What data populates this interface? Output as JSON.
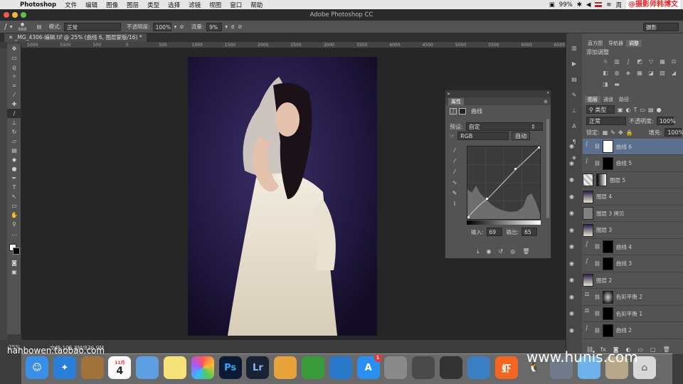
{
  "menubar": {
    "app": "Photoshop",
    "items": [
      "文件",
      "编辑",
      "图像",
      "图层",
      "类型",
      "选择",
      "滤镜",
      "视图",
      "窗口",
      "帮助"
    ],
    "battery": "99%",
    "clock": "周",
    "watermark": "@摄影师韩博文"
  },
  "titlebar": {
    "title": "Adobe Photoshop CC"
  },
  "options": {
    "brush_size": "669",
    "mode_label": "模式:",
    "mode_value": "正常",
    "opacity_label": "不透明度:",
    "opacity_value": "100%",
    "flow_label": "流量:",
    "flow_value": "9%",
    "workspace": "摄影"
  },
  "document": {
    "tab": "_MG_4306-编辑.tif @ 25% (曲线 6, 图层蒙版/16) *",
    "ruler_ticks": [
      "5000",
      "5500",
      "500",
      "0",
      "500",
      "1000",
      "1500",
      "2000",
      "2500",
      "3000",
      "3500",
      "4000",
      "4500",
      "5000",
      "5500",
      "6000",
      "6500"
    ],
    "zoom": "25%",
    "doc_info": "文档:105.8M/836.9M"
  },
  "properties": {
    "tab": "属性",
    "panel_title": "曲线",
    "preset_label": "预设:",
    "preset_value": "自定",
    "channel": "RGB",
    "auto_button": "自动",
    "input_label": "输入:",
    "input_value": "69",
    "output_label": "输出:",
    "output_value": "65"
  },
  "right_panel": {
    "top_tabs": [
      "直方图",
      "导航器",
      "调整"
    ],
    "adjust_title": "添加调整",
    "layer_tabs": [
      "图层",
      "通道",
      "路径"
    ],
    "filter_label": "类型",
    "blend_mode": "正常",
    "opacity_label": "不透明度:",
    "opacity_value": "100%",
    "lock_label": "锁定:",
    "fill_label": "填充:",
    "fill_value": "100%",
    "layers": [
      {
        "name": "曲线 6",
        "kind": "curve",
        "mask": "white"
      },
      {
        "name": "曲线 5",
        "kind": "curve",
        "mask": "black"
      },
      {
        "name": "图层 5",
        "kind": "pixel",
        "mask": "grad"
      },
      {
        "name": "图层 4",
        "kind": "photo",
        "mask": "none"
      },
      {
        "name": "图层 3 拷贝",
        "kind": "gray",
        "mask": "none"
      },
      {
        "name": "图层 3",
        "kind": "photo",
        "mask": "none"
      },
      {
        "name": "曲线 4",
        "kind": "curve",
        "mask": "black"
      },
      {
        "name": "曲线 3",
        "kind": "curve",
        "mask": "black"
      },
      {
        "name": "图层 2",
        "kind": "photo",
        "mask": "none"
      },
      {
        "name": "色彩平衡 2",
        "kind": "balance",
        "mask": "figure"
      },
      {
        "name": "色彩平衡 1",
        "kind": "balance",
        "mask": "black"
      },
      {
        "name": "曲线 2",
        "kind": "curve",
        "mask": "black"
      }
    ]
  },
  "dock": {
    "items": [
      "finder",
      "safari",
      "contacts",
      "calendar",
      "mail",
      "notes",
      "photos",
      "photoshop",
      "lightroom",
      "preview",
      "numbers",
      "keynote",
      "app-store",
      "system-preferences",
      "screenshot",
      "final-cut",
      "xcode",
      "xiami",
      "qq",
      "launchpad",
      "messenger",
      "image",
      "trash"
    ],
    "calendar_month": "11月",
    "calendar_day": "4",
    "ps_label": "Ps",
    "lr_label": "Lr",
    "xiami_label": "虾",
    "appstore_badge": "1"
  },
  "watermarks": {
    "left": "hanbowen.taobao.com",
    "right": "www.hunis.com"
  }
}
